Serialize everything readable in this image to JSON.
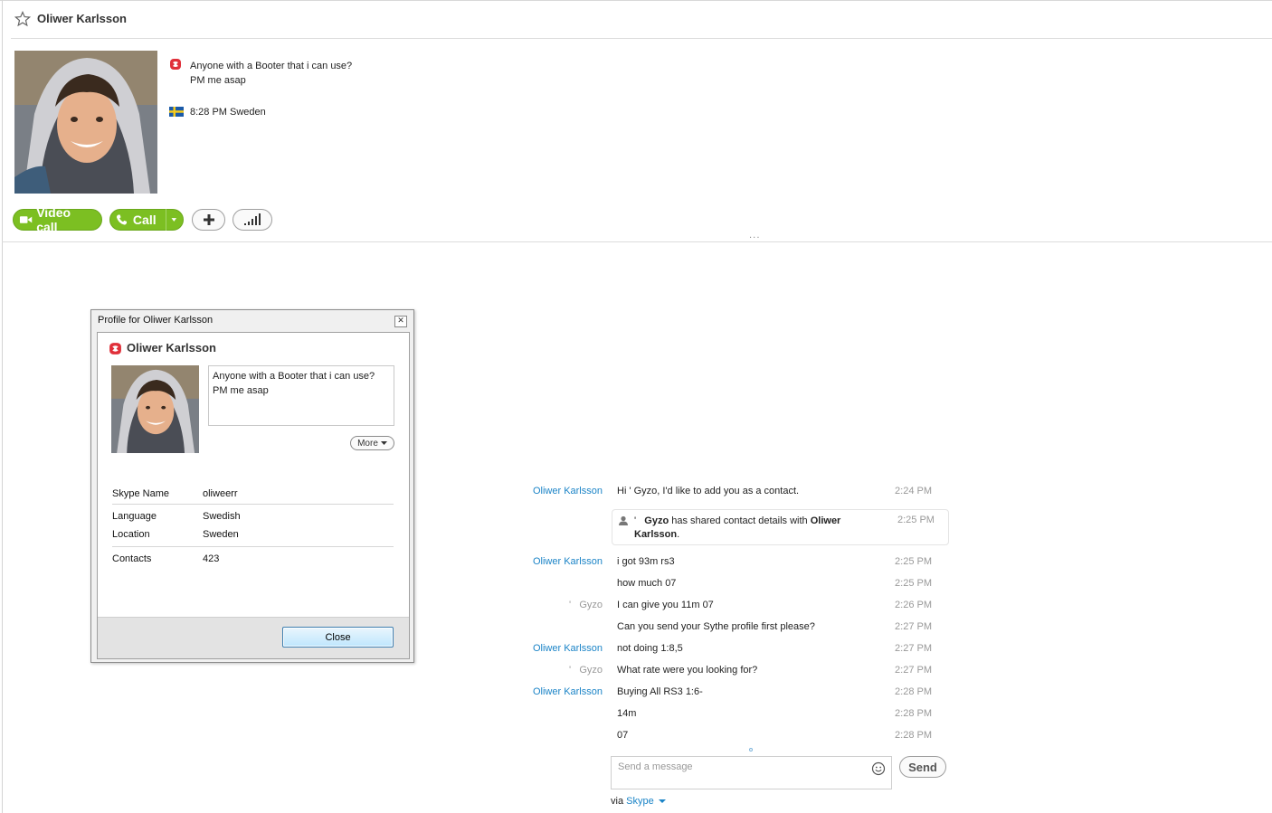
{
  "contact": {
    "name": "Oliwer Karlsson",
    "mood_line1": "Anyone with a Booter that i can use?",
    "mood_line2": "PM me asap",
    "local_time": "8:28 PM Sweden"
  },
  "toolbar": {
    "video_call_label": "Video call",
    "call_label": "Call"
  },
  "profile_dialog": {
    "title": "Profile for Oliwer Karlsson",
    "name": "Oliwer Karlsson",
    "mood_line1": "Anyone with a Booter that i can use?",
    "mood_line2": "PM me asap",
    "more_label": "More",
    "fields": [
      {
        "label": "Skype Name",
        "value": "oliweerr"
      },
      {
        "label": "Language",
        "value": "Swedish"
      },
      {
        "label": "Location",
        "value": "Sweden"
      },
      {
        "label": "Contacts",
        "value": "423"
      }
    ],
    "close_label": "Close"
  },
  "chat": {
    "messages": [
      {
        "sender": "Oliwer Karlsson",
        "text": "Hi '   Gyzo, I'd like to add you as a contact.",
        "time": "2:24 PM"
      },
      {
        "sender": "Oliwer Karlsson",
        "text": "i got 93m rs3",
        "time": "2:25 PM"
      },
      {
        "sender": "",
        "text": "how much 07",
        "time": "2:25 PM"
      },
      {
        "sender": "'   Gyzo",
        "text": "I can give you 11m 07",
        "time": "2:26 PM"
      },
      {
        "sender": "",
        "text": "Can you send your Sythe profile first please?",
        "time": "2:27 PM"
      },
      {
        "sender": "Oliwer Karlsson",
        "text": "not doing 1:8,5",
        "time": "2:27 PM"
      },
      {
        "sender": "'   Gyzo",
        "text": "What rate were you looking for?",
        "time": "2:27 PM"
      },
      {
        "sender": "Oliwer Karlsson",
        "text": "Buying All RS3 1:6-",
        "time": "2:28 PM"
      },
      {
        "sender": "",
        "text": "14m",
        "time": "2:28 PM"
      },
      {
        "sender": "",
        "text": "07",
        "time": "2:28 PM"
      }
    ],
    "shared_card": {
      "prefix": "'",
      "from": "Gyzo",
      "middle": " has shared contact details with ",
      "to": "Oliwer Karlsson",
      "suffix": ".",
      "time": "2:25 PM"
    },
    "input_placeholder": "Send a message",
    "send_label": "Send",
    "via_label": "via",
    "via_service": "Skype"
  }
}
